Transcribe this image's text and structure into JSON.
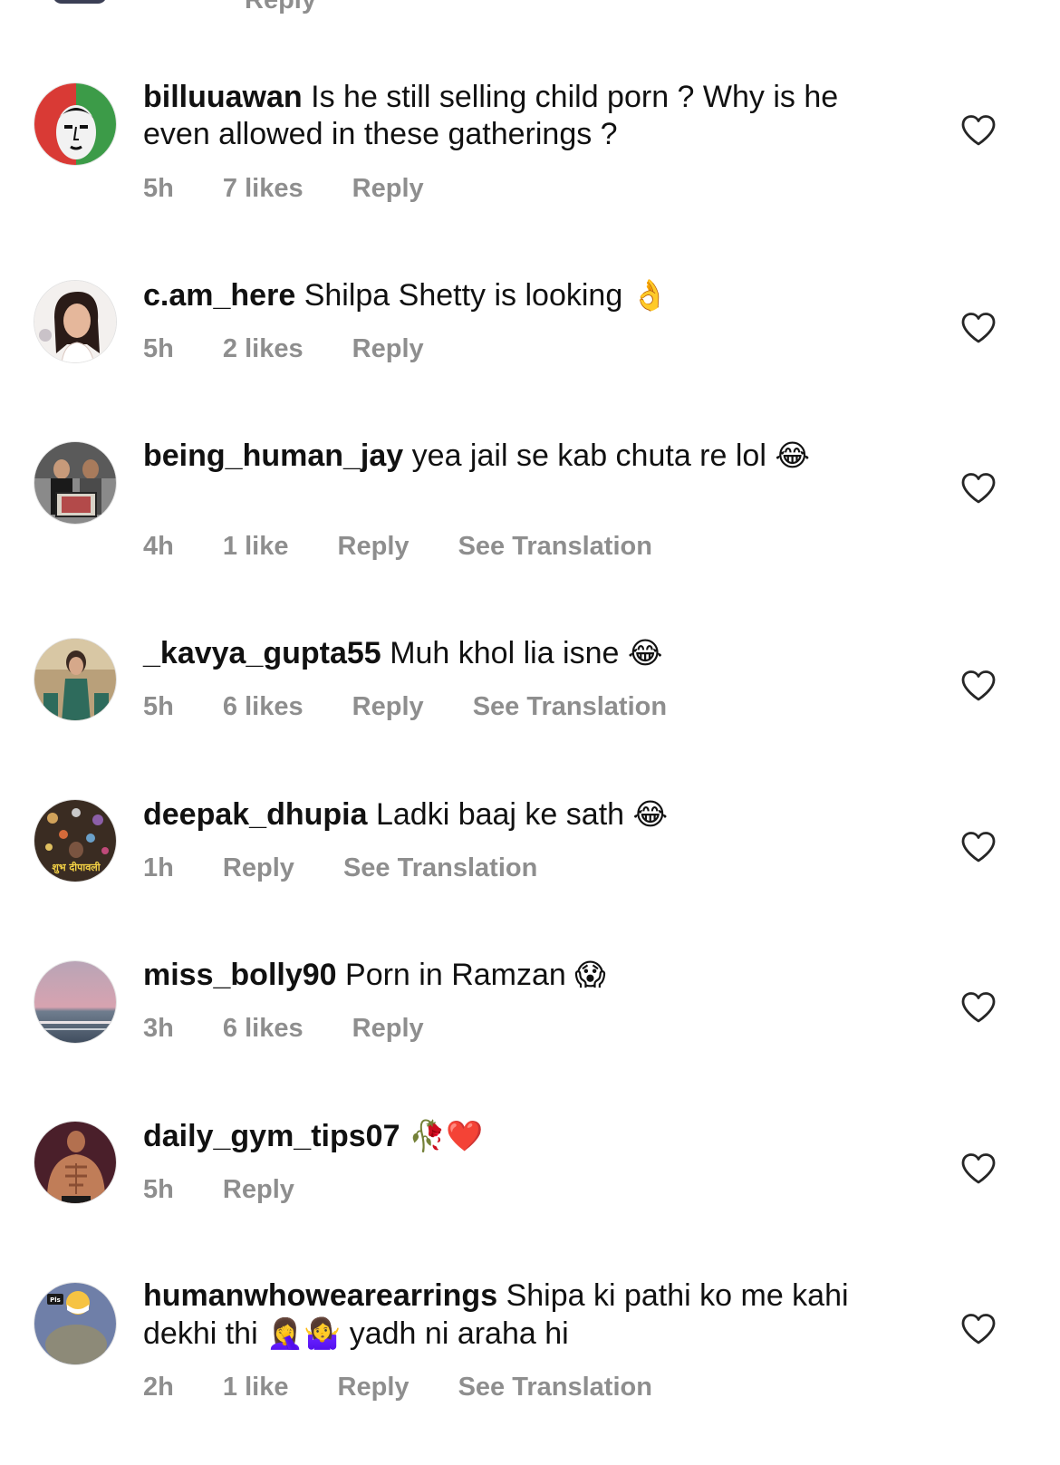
{
  "top_partial": {
    "reply_label": "Reply"
  },
  "comments": [
    {
      "username": "billuuawan",
      "text": "Is he still selling child porn ? Why is he even allowed in these gatherings ?",
      "emoji": "",
      "time": "5h",
      "likes": "7 likes",
      "reply": "Reply",
      "translation": ""
    },
    {
      "username": "c.am_here",
      "text": "Shilpa Shetty is looking",
      "emoji": "👌",
      "time": "5h",
      "likes": "2 likes",
      "reply": "Reply",
      "translation": ""
    },
    {
      "username": "being_human_jay",
      "text": "yea jail se kab chuta re lol",
      "emoji": "😂",
      "time": "4h",
      "likes": "1 like",
      "reply": "Reply",
      "translation": "See Translation"
    },
    {
      "username": "_kavya_gupta55",
      "text": "Muh khol lia isne",
      "emoji": "😂",
      "time": "5h",
      "likes": "6 likes",
      "reply": "Reply",
      "translation": "See Translation"
    },
    {
      "username": "deepak_dhupia",
      "text": "Ladki baaj ke sath",
      "emoji": "😂",
      "time": "1h",
      "likes": "",
      "reply": "Reply",
      "translation": "See Translation"
    },
    {
      "username": "miss_bolly90",
      "text": "Porn in Ramzan",
      "emoji": "😱",
      "time": "3h",
      "likes": "6 likes",
      "reply": "Reply",
      "translation": ""
    },
    {
      "username": "daily_gym_tips07",
      "text": "",
      "emoji": "🥀❤️",
      "time": "5h",
      "likes": "",
      "reply": "Reply",
      "translation": ""
    },
    {
      "username": "humanwhowearearrings",
      "text": "Shipa ki pathi ko me kahi dekhi thi",
      "emoji": "🤦‍♀️🤷‍♀️",
      "text_after_emoji": "yadh ni araha hi",
      "time": "2h",
      "likes": "1 like",
      "reply": "Reply",
      "translation": "See Translation"
    }
  ],
  "icons": {
    "like": "heart-outline-icon"
  },
  "colors": {
    "text": "#111111",
    "meta": "#8e8e8e",
    "heart_stroke": "#262626"
  },
  "avatar_badges": {
    "deepak_dhupia": "शुभ दीपावली",
    "humanwhowearearrings": "Pls"
  }
}
